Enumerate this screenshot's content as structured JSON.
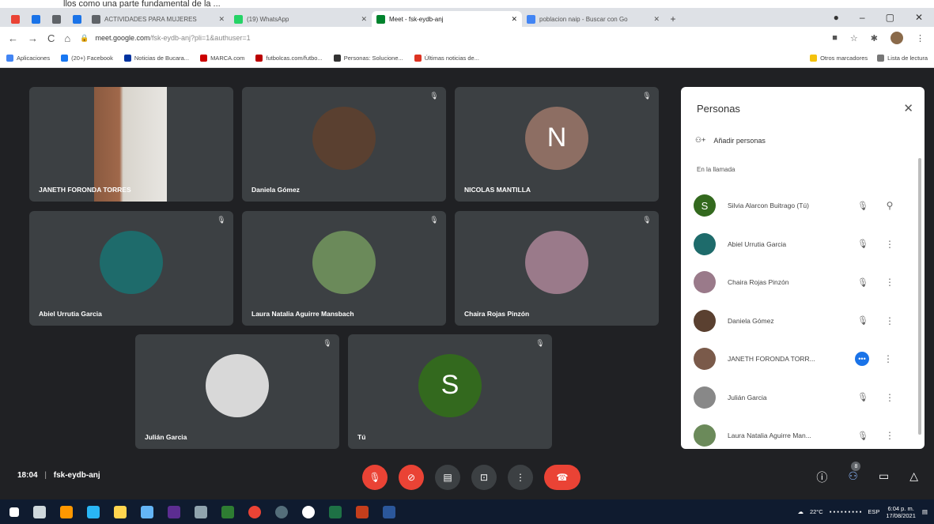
{
  "top_banner_text": "llos como una parte fundamental de la ...",
  "tabs": [
    {
      "label": "",
      "color": "#ea4335",
      "small": true
    },
    {
      "label": "",
      "color": "#1a73e8",
      "small": true
    },
    {
      "label": "",
      "color": "#5f6368",
      "small": true
    },
    {
      "label": "",
      "color": "#1a73e8",
      "small": true
    },
    {
      "label": "ACTIVIDADES PARA MUJERES",
      "color": "#5f6368"
    },
    {
      "label": "(19) WhatsApp",
      "color": "#25d366"
    },
    {
      "label": "Meet - fsk-eydb-anj",
      "color": "#00832d",
      "active": true
    },
    {
      "label": "poblacion naip - Buscar con Go",
      "color": "#4285f4"
    }
  ],
  "address": {
    "host": "meet.google.com",
    "path": "/fsk-eydb-anj?pli=1&authuser=1"
  },
  "bookmarks": [
    {
      "label": "Aplicaciones",
      "color": "#4285f4"
    },
    {
      "label": "(20+) Facebook",
      "color": "#1877f2"
    },
    {
      "label": "Noticias de Bucara...",
      "color": "#0033a0"
    },
    {
      "label": "MARCA.com",
      "color": "#c00"
    },
    {
      "label": "futbolcas.com/futbo...",
      "color": "#b00"
    },
    {
      "label": "Personas: Solucione...",
      "color": "#333"
    },
    {
      "label": "Últimas noticias de...",
      "color": "#d32"
    }
  ],
  "bookmarks_right": [
    "Otros marcadores",
    "Lista de lectura"
  ],
  "tiles": [
    {
      "name": "JANETH FORONDA TORRES",
      "type": "photo",
      "color": "#7a5a4a"
    },
    {
      "name": "Daniela Gómez",
      "type": "photo",
      "color": "#5a4030"
    },
    {
      "name": "NICOLAS MANTILLA",
      "type": "letter",
      "letter": "N",
      "color": "#8d6e63"
    },
    {
      "name": "Abiel Urrutia Garcia",
      "type": "photo",
      "color": "#1e6b6b"
    },
    {
      "name": "Laura Natalia Aguirre Mansbach",
      "type": "photo",
      "color": "#6b8a5a"
    },
    {
      "name": "Chaira Rojas Pinzón",
      "type": "photo",
      "color": "#9a7a8a"
    },
    {
      "name": "Julián Garcia",
      "type": "photo",
      "color": "#d8d8d8"
    },
    {
      "name": "Tú",
      "type": "letter",
      "letter": "S",
      "color": "#33691e"
    }
  ],
  "panel": {
    "title": "Personas",
    "add_people": "Añadir personas",
    "section": "En la llamada",
    "participants": [
      {
        "name": "Silvia Alarcon Buitrago (Tú)",
        "letter": "S",
        "color": "#33691e",
        "extra": "pin"
      },
      {
        "name": "Abiel Urrutia Garcia",
        "color": "#1e6b6b"
      },
      {
        "name": "Chaira Rojas Pinzón",
        "color": "#9a7a8a"
      },
      {
        "name": "Daniela Gómez",
        "color": "#5a4030"
      },
      {
        "name": "JANETH FORONDA TORR...",
        "color": "#7a5a4a",
        "speaking": true
      },
      {
        "name": "Julián Garcia",
        "color": "#888"
      },
      {
        "name": "Laura Natalia Aguirre Man...",
        "color": "#6b8a5a"
      }
    ]
  },
  "meeting": {
    "time": "18:04",
    "code": "fsk-eydb-anj",
    "participant_count": "8"
  },
  "taskbar": {
    "temp": "22°C",
    "lang": "ESP",
    "time": "6:04 p. m.",
    "date": "17/08/2021"
  }
}
